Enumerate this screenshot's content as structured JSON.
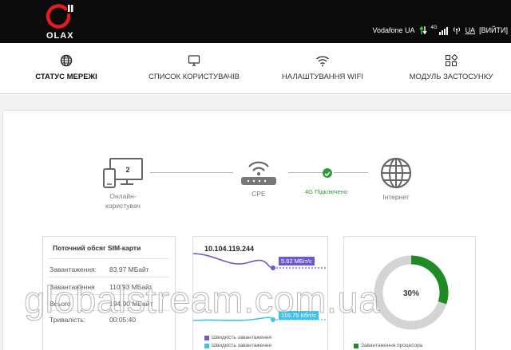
{
  "brand": {
    "name": "OLAX"
  },
  "header": {
    "operator": "Vodafone UA",
    "network_badge": "4G",
    "language": "UA",
    "logout": "[ВИЙТИ]"
  },
  "nav": {
    "items": [
      {
        "label": "СТАТУС МЕРЕЖІ",
        "icon": "globe-icon",
        "active": true
      },
      {
        "label": "СПИСОК КОРИСТУВАЧІВ",
        "icon": "monitor-icon",
        "active": false
      },
      {
        "label": "НАЛАШТУВАННЯ WIFI",
        "icon": "wifi-icon",
        "active": false
      },
      {
        "label": "МОДУЛЬ ЗАСТОСУНКУ",
        "icon": "apps-grid-icon",
        "active": false
      }
    ]
  },
  "diagram": {
    "users_count": "2",
    "users_label_line1": "Онлайн-",
    "users_label_line2": "користувач",
    "cpe_label": "CPE",
    "connection_status": "4G Підключено",
    "internet_label": "Інтернет",
    "status_color": "#2f9a3a"
  },
  "sim_usage": {
    "title": "Поточний обсяг SIM-карти",
    "rows": [
      {
        "key": "Завантаження:",
        "value": "83.97 МБайт"
      },
      {
        "key": "Завантаження",
        "value": "110.93 МБайт"
      },
      {
        "key": "Всього",
        "value": "194.90 МБайт"
      },
      {
        "key": "Тривалість:",
        "value": "00:05:40"
      }
    ]
  },
  "traffic": {
    "ip": "10.104.119.244",
    "download_rate": "5.62 МБіт/с",
    "upload_rate": "116.75 Кбіт/с",
    "legend_download": "Швидкість завантаження",
    "legend_upload": "Швидкість завантаження",
    "download_color": "#6a5acd",
    "upload_color": "#3ec3e6"
  },
  "cpu": {
    "percent": 30,
    "percent_label": "30%",
    "legend": "Завантаження процесора",
    "color": "#1f8b24"
  },
  "watermark": "globalstream.com.ua"
}
